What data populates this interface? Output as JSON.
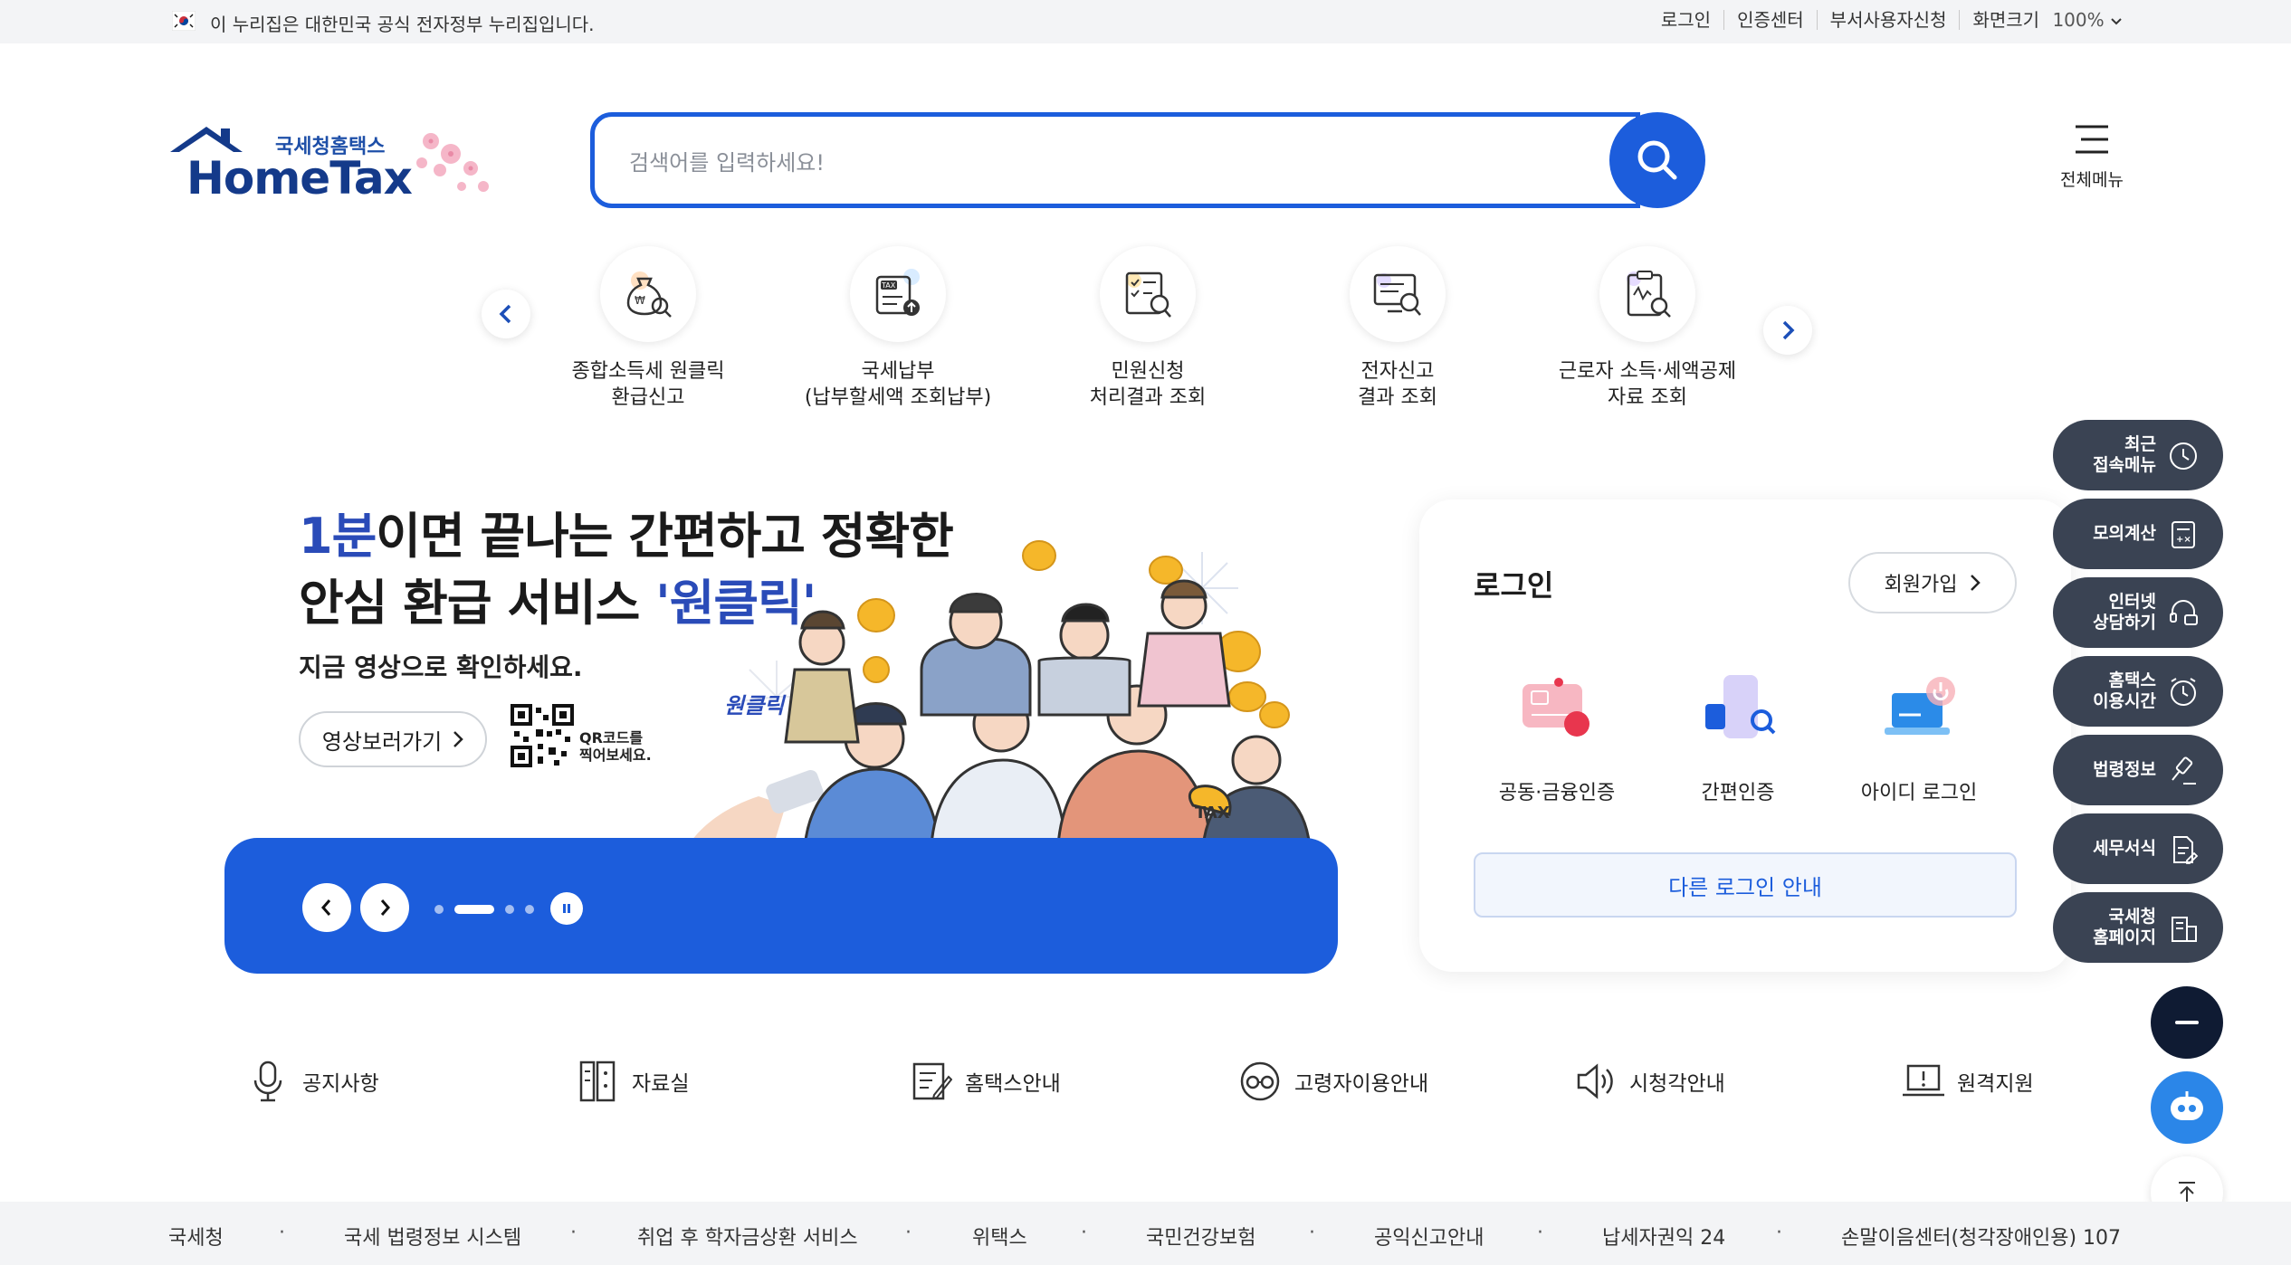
{
  "govbar": {
    "notice": "이 누리집은 대한민국 공식 전자정부 누리집입니다.",
    "links": [
      "로그인",
      "인증센터",
      "부서사용자신청"
    ],
    "zoom_label": "화면크기",
    "zoom_value": "100%"
  },
  "logo": {
    "sub": "국세청홈택스",
    "main": "HomeTax"
  },
  "search": {
    "placeholder": "검색어를 입력하세요!"
  },
  "allmenu": {
    "label": "전체메뉴"
  },
  "quick_menu": [
    {
      "line1": "종합소득세 원클릭",
      "line2": "환급신고",
      "icon": "money-bag-search-icon"
    },
    {
      "line1": "국세납부",
      "line2": "(납부할세액 조회납부)",
      "icon": "tax-document-upload-icon"
    },
    {
      "line1": "민원신청",
      "line2": "처리결과 조회",
      "icon": "checklist-search-icon"
    },
    {
      "line1": "전자신고",
      "line2": "결과 조회",
      "icon": "monitor-search-icon"
    },
    {
      "line1": "근로자 소득·세액공제",
      "line2": "자료 조회",
      "icon": "clipboard-search-icon"
    }
  ],
  "banner": {
    "headline_hl": "1분",
    "headline_rest1": "이면 끝나는 간편하고 정확한",
    "headline_line2a": "안심 환급 서비스 ",
    "headline_line2b": "'원클릭'",
    "desc": "지금 영상으로 확인하세요.",
    "video_button": "영상보러가기",
    "qr_text1": "QR코드를",
    "qr_text2": "찍어보세요.",
    "badge": "원클릭 환급",
    "bag_text": "TAX",
    "active_slide": 2,
    "slide_count": 4
  },
  "login": {
    "title": "로그인",
    "join": "회원가입",
    "options": [
      "공동·금융인증",
      "간편인증",
      "아이디 로그인"
    ],
    "other": "다른 로그인 안내"
  },
  "side_menu": [
    {
      "label1": "최근",
      "label2": "접속메뉴",
      "icon": "clock-icon"
    },
    {
      "label1": "모의계산",
      "label2": "",
      "icon": "calculator-icon"
    },
    {
      "label1": "인터넷",
      "label2": "상담하기",
      "icon": "chat-headset-icon"
    },
    {
      "label1": "홈택스",
      "label2": "이용시간",
      "icon": "alarm-icon"
    },
    {
      "label1": "법령정보",
      "label2": "",
      "icon": "gavel-icon"
    },
    {
      "label1": "세무서식",
      "label2": "",
      "icon": "form-document-icon"
    },
    {
      "label1": "국세청",
      "label2": "홈페이지",
      "icon": "building-link-icon"
    }
  ],
  "bottom_links": [
    "공지사항",
    "자료실",
    "홈택스안내",
    "고령자이용안내",
    "시청각안내",
    "원격지원"
  ],
  "footer": [
    "국세청",
    "국세 법령정보 시스템",
    "취업 후 학자금상환 서비스",
    "위택스",
    "국민건강보험",
    "공익신고안내",
    "납세자권익 24",
    "손말이음센터(청각장애인용) 107"
  ],
  "colors": {
    "primary": "#1c5ddc",
    "navy": "#3a4353",
    "logo": "#143a8a"
  }
}
